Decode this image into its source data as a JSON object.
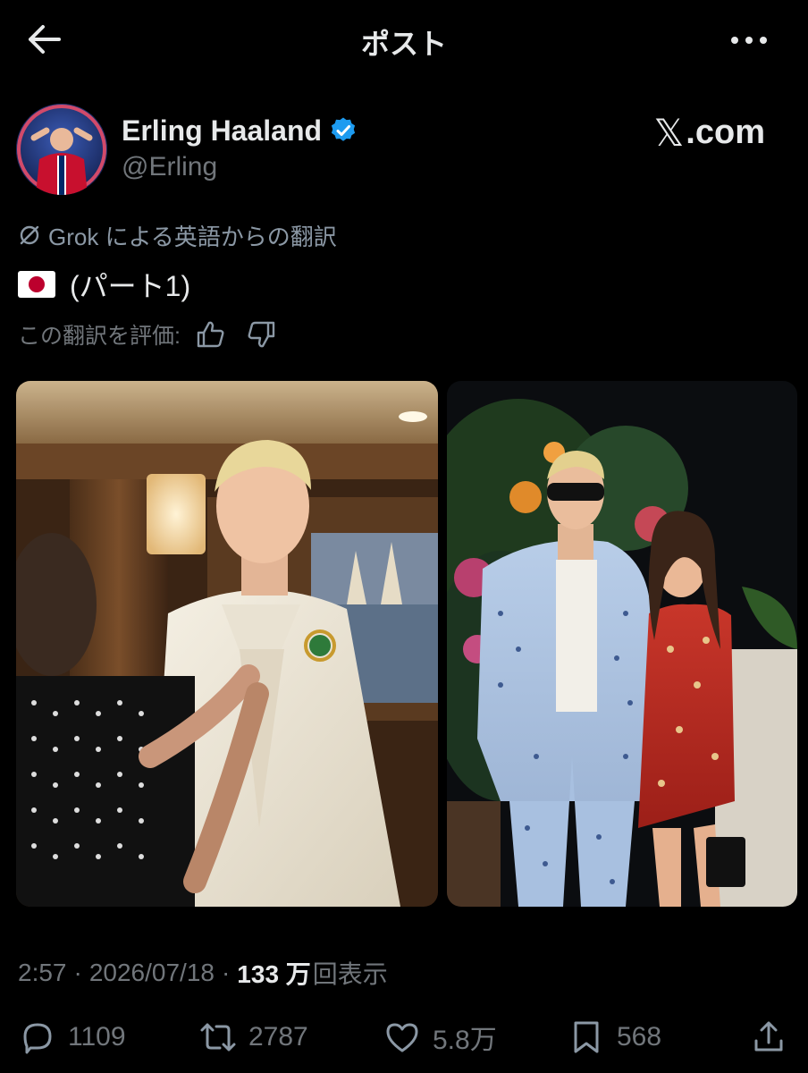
{
  "header": {
    "title": "ポスト"
  },
  "author": {
    "name": "Erling Haaland",
    "handle": "@Erling",
    "verified": true,
    "verified_color": "#1d9bf0"
  },
  "brand": {
    "x_glyph": "𝕏",
    "domain": ".com"
  },
  "translation": {
    "label": "Grok による英語からの翻訳",
    "text": "(パート1)",
    "rate_label": "この翻訳を評価:"
  },
  "meta": {
    "time": "2:57",
    "date": "2026/07/18",
    "views_count": "133 万",
    "views_label": "回表示",
    "separator": "·"
  },
  "actions": {
    "replies": "1109",
    "reposts": "2787",
    "likes": "5.8万",
    "bookmarks": "568"
  },
  "icons": {
    "back": "arrow-left-icon",
    "more": "more-horizontal-icon",
    "verified": "verified-badge-icon",
    "translate": "translate-icon",
    "flag": "japan-flag-icon",
    "thumbs_up": "thumbs-up-icon",
    "thumbs_down": "thumbs-down-icon",
    "reply": "reply-icon",
    "repost": "repost-icon",
    "like": "heart-icon",
    "bookmark": "bookmark-icon",
    "share": "share-icon"
  },
  "colors": {
    "background": "#000000",
    "text_primary": "#e7e9ea",
    "text_secondary": "#71767b",
    "accent": "#1d9bf0"
  }
}
